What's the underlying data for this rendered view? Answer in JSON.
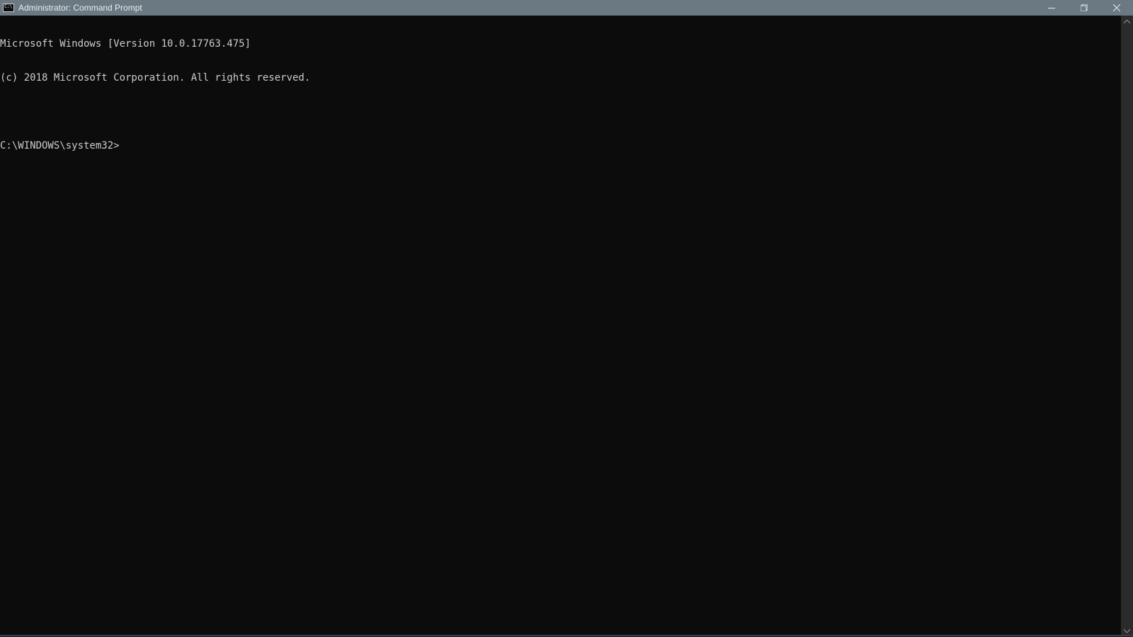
{
  "window": {
    "title": "Administrator: Command Prompt"
  },
  "terminal": {
    "lines": [
      "Microsoft Windows [Version 10.0.17763.475]",
      "(c) 2018 Microsoft Corporation. All rights reserved."
    ],
    "prompt": "C:\\WINDOWS\\system32>"
  }
}
